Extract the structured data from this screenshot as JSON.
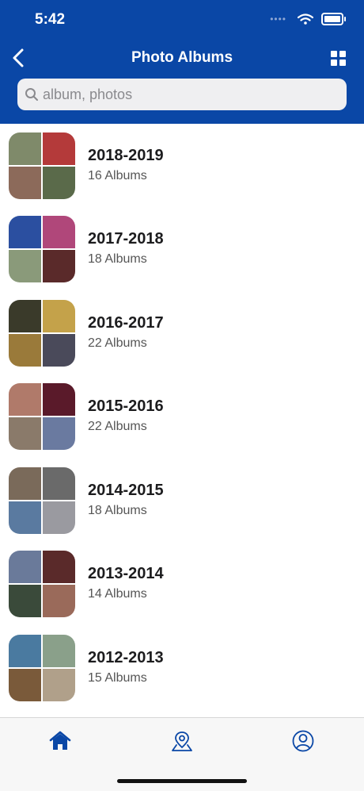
{
  "status": {
    "time": "5:42"
  },
  "nav": {
    "title": "Photo Albums"
  },
  "search": {
    "placeholder": "album, photos"
  },
  "albums": [
    {
      "year": "2018-2019",
      "count": "16 Albums",
      "colors": [
        "#7f8a6a",
        "#b43a3a",
        "#8c6a5a",
        "#5a6a4a"
      ]
    },
    {
      "year": "2017-2018",
      "count": "18 Albums",
      "colors": [
        "#2b4fa0",
        "#b0477a",
        "#8a9a7a",
        "#5a2a2a"
      ]
    },
    {
      "year": "2016-2017",
      "count": "22 Albums",
      "colors": [
        "#3a3a2a",
        "#c4a24a",
        "#9a7a3a",
        "#4a4a5a"
      ]
    },
    {
      "year": "2015-2016",
      "count": "22 Albums",
      "colors": [
        "#b07a6a",
        "#5a1a2a",
        "#8a7a6a",
        "#6a7aa0"
      ]
    },
    {
      "year": "2014-2015",
      "count": "18 Albums",
      "colors": [
        "#7a6a5a",
        "#6a6a6a",
        "#5a7aa0",
        "#9a9aa0"
      ]
    },
    {
      "year": "2013-2014",
      "count": "14 Albums",
      "colors": [
        "#6a7a9a",
        "#5a2a2a",
        "#3a4a3a",
        "#9a6a5a"
      ]
    },
    {
      "year": "2012-2013",
      "count": "15 Albums",
      "colors": [
        "#4a7aa0",
        "#8aa08a",
        "#7a5a3a",
        "#b0a08a"
      ]
    }
  ],
  "tabs": [
    {
      "name": "home",
      "icon": "home-icon",
      "active": true
    },
    {
      "name": "map",
      "icon": "map-pin-icon",
      "active": false
    },
    {
      "name": "profile",
      "icon": "profile-icon",
      "active": false
    }
  ],
  "colors": {
    "brand": "#0a47a6",
    "active_tab": "#0a47a6"
  }
}
